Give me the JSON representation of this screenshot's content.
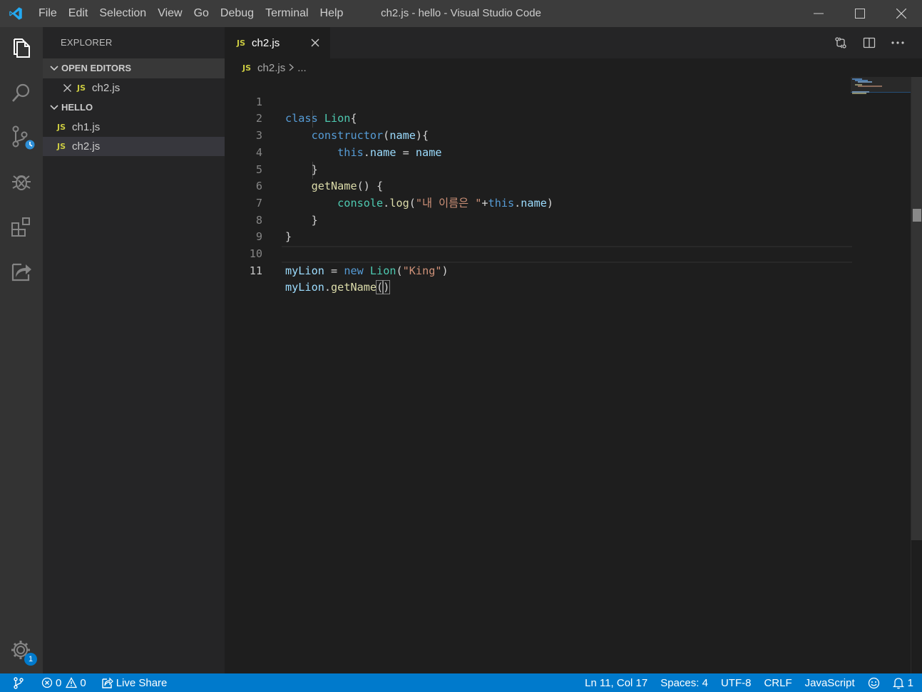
{
  "window": {
    "title": "ch2.js - hello - Visual Studio Code",
    "menu": [
      "File",
      "Edit",
      "Selection",
      "View",
      "Go",
      "Debug",
      "Terminal",
      "Help"
    ]
  },
  "activity_bar": {
    "items": [
      "explorer-icon",
      "search-icon",
      "source-control-icon",
      "debug-icon",
      "extensions-icon",
      "live-share-icon"
    ],
    "settings_badge": "1"
  },
  "sidebar": {
    "title": "EXPLORER",
    "open_editors": {
      "label": "OPEN EDITORS",
      "items": [
        {
          "badge": "JS",
          "name": "ch2.js"
        }
      ]
    },
    "folder": {
      "label": "HELLO",
      "items": [
        {
          "badge": "JS",
          "name": "ch1.js"
        },
        {
          "badge": "JS",
          "name": "ch2.js"
        }
      ]
    }
  },
  "editor": {
    "tab": {
      "badge": "JS",
      "label": "ch2.js"
    },
    "breadcrumb": {
      "badge": "JS",
      "file": "ch2.js",
      "rest": "..."
    },
    "line_numbers": [
      "1",
      "2",
      "3",
      "4",
      "5",
      "6",
      "7",
      "8",
      "9",
      "10",
      "11"
    ],
    "active_line": 11
  },
  "statusbar": {
    "errors": "0",
    "warnings": "0",
    "live_share": "Live Share",
    "position": "Ln 11, Col 17",
    "spaces": "Spaces: 4",
    "encoding": "UTF-8",
    "eol": "CRLF",
    "language": "JavaScript",
    "notifications": "1"
  },
  "colors": {
    "accent": "#007acc",
    "keyword": "#569cd6",
    "class": "#4ec9b0",
    "function": "#dcdcaa",
    "variable": "#9cdcfe",
    "string": "#ce9178",
    "js_icon": "#cbcb41"
  }
}
